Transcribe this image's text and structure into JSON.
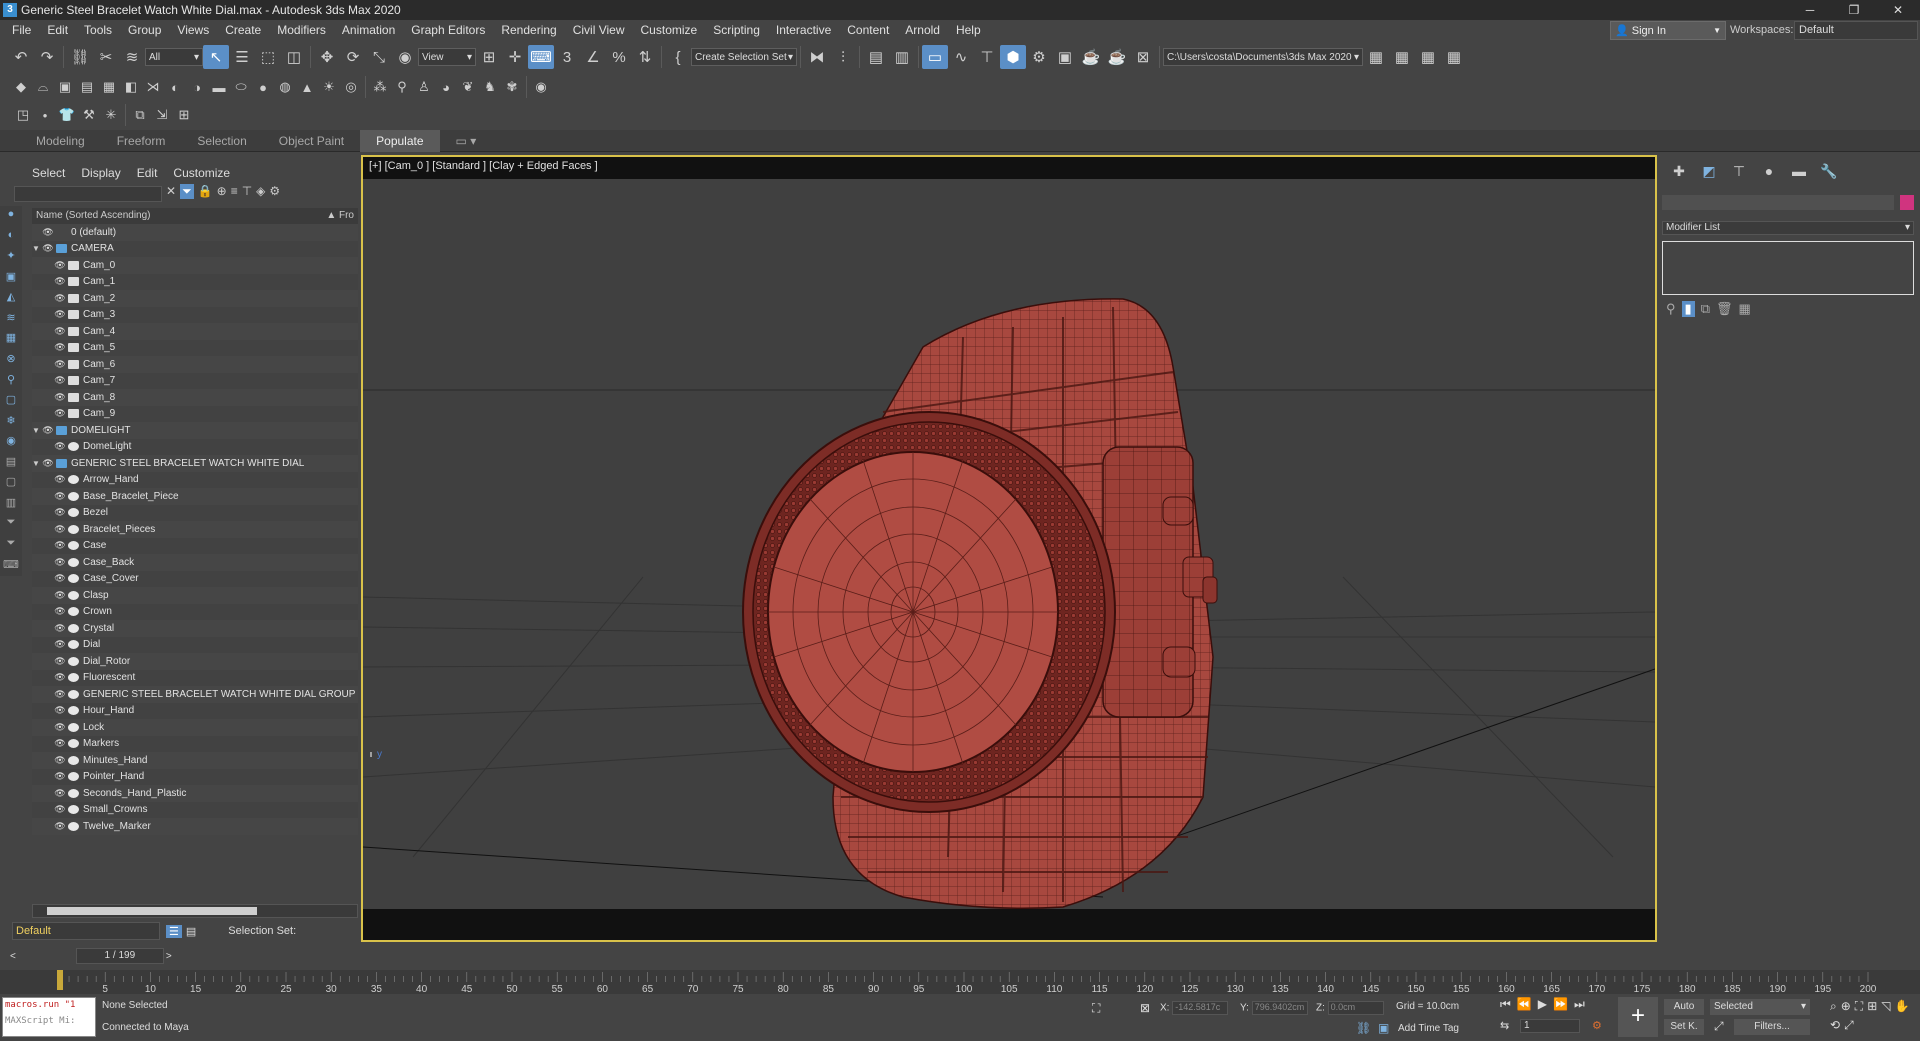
{
  "window": {
    "title": "Generic Steel Bracelet Watch White Dial.max - Autodesk 3ds Max 2020",
    "min": "─",
    "max": "❐",
    "close": "✕"
  },
  "menu": [
    "File",
    "Edit",
    "Tools",
    "Group",
    "Views",
    "Create",
    "Modifiers",
    "Animation",
    "Graph Editors",
    "Rendering",
    "Civil View",
    "Customize",
    "Scripting",
    "Interactive",
    "Content",
    "Arnold",
    "Help"
  ],
  "account": {
    "sign_in": "Sign In",
    "workspaces_label": "Workspaces:",
    "workspace": "Default"
  },
  "toolbar": {
    "filter": "All",
    "refcoord": "View",
    "selection_set": "Create Selection Set",
    "project_path": "C:\\Users\\costa\\Documents\\3ds Max 2020"
  },
  "ribbon": {
    "tabs": [
      "Modeling",
      "Freeform",
      "Selection",
      "Object Paint",
      "Populate"
    ],
    "active": "Populate"
  },
  "scene_explorer": {
    "tabs": [
      "Select",
      "Display",
      "Edit",
      "Customize"
    ],
    "column_name": "Name (Sorted Ascending)",
    "column_frozen": "▲ Fro",
    "items": [
      {
        "label": "0 (default)",
        "level": 0
      },
      {
        "label": "CAMERA",
        "level": 0
      },
      {
        "label": "Cam_0",
        "level": 1
      },
      {
        "label": "Cam_1",
        "level": 1
      },
      {
        "label": "Cam_2",
        "level": 1
      },
      {
        "label": "Cam_3",
        "level": 1
      },
      {
        "label": "Cam_4",
        "level": 1
      },
      {
        "label": "Cam_5",
        "level": 1
      },
      {
        "label": "Cam_6",
        "level": 1
      },
      {
        "label": "Cam_7",
        "level": 1
      },
      {
        "label": "Cam_8",
        "level": 1
      },
      {
        "label": "Cam_9",
        "level": 1
      },
      {
        "label": "DOMELIGHT",
        "level": 0
      },
      {
        "label": "DomeLight",
        "level": 1
      },
      {
        "label": "GENERIC STEEL BRACELET WATCH WHITE DIAL",
        "level": 0
      },
      {
        "label": "Arrow_Hand",
        "level": 1
      },
      {
        "label": "Base_Bracelet_Piece",
        "level": 1
      },
      {
        "label": "Bezel",
        "level": 1
      },
      {
        "label": "Bracelet_Pieces",
        "level": 1
      },
      {
        "label": "Case",
        "level": 1
      },
      {
        "label": "Case_Back",
        "level": 1
      },
      {
        "label": "Case_Cover",
        "level": 1
      },
      {
        "label": "Clasp",
        "level": 1
      },
      {
        "label": "Crown",
        "level": 1
      },
      {
        "label": "Crystal",
        "level": 1
      },
      {
        "label": "Dial",
        "level": 1
      },
      {
        "label": "Dial_Rotor",
        "level": 1
      },
      {
        "label": "Fluorescent",
        "level": 1
      },
      {
        "label": "GENERIC STEEL BRACELET WATCH WHITE DIAL GROUP",
        "level": 1
      },
      {
        "label": "Hour_Hand",
        "level": 1
      },
      {
        "label": "Lock",
        "level": 1
      },
      {
        "label": "Markers",
        "level": 1
      },
      {
        "label": "Minutes_Hand",
        "level": 1
      },
      {
        "label": "Pointer_Hand",
        "level": 1
      },
      {
        "label": "Seconds_Hand_Plastic",
        "level": 1
      },
      {
        "label": "Small_Crowns",
        "level": 1
      },
      {
        "label": "Twelve_Marker",
        "level": 1
      }
    ],
    "layer": "Default",
    "selection_set_label": "Selection Set:"
  },
  "viewport": {
    "label": "[+] [Cam_0 ] [Standard ] [Clay + Edged Faces ]",
    "accent": "#d9c24a",
    "model_color": "#a8483f"
  },
  "command_panel": {
    "modifier_list": "Modifier List",
    "object_color": "#d0347f"
  },
  "time": {
    "slider": "1 / 199",
    "ticks": [
      "5",
      "10",
      "15",
      "20",
      "25",
      "30",
      "35",
      "40",
      "45",
      "50",
      "55",
      "60",
      "65",
      "70",
      "75",
      "80",
      "85",
      "90",
      "95",
      "100",
      "105",
      "110",
      "115",
      "120",
      "125",
      "130",
      "135",
      "140",
      "145",
      "150",
      "155",
      "160",
      "165",
      "170",
      "175",
      "180",
      "185",
      "190",
      "195",
      "200"
    ]
  },
  "status": {
    "maxscript_line1": "macros.run \"1",
    "maxscript_line2": "MAXScript Mi:",
    "selection": "None Selected",
    "message": "Connected to Maya",
    "x_label": "X:",
    "x_val": "-142.5817c",
    "y_label": "Y:",
    "y_val": "796.9402cm",
    "z_label": "Z:",
    "z_val": "0.0cm",
    "grid": "Grid = 10.0cm",
    "add_time_tag": "Add Time Tag",
    "frame": "1",
    "auto": "Auto",
    "set_key": "Set K.",
    "key_filter": "Selected",
    "filters": "Filters..."
  }
}
